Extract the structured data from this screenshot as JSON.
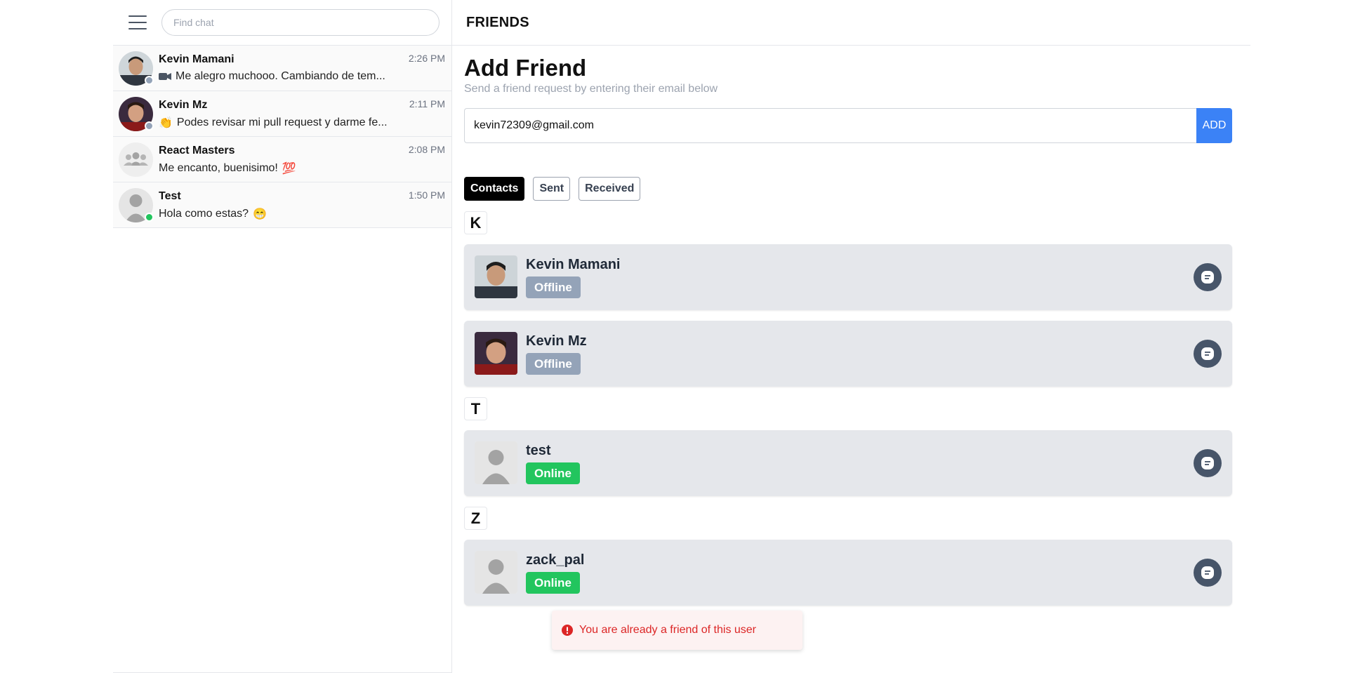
{
  "sidebar": {
    "search_placeholder": "Find chat",
    "chats": [
      {
        "name": "Kevin Mamani",
        "time": "2:26 PM",
        "message": "Me alegro muchooo. Cambiando de tem...",
        "icon": "video-camera-icon",
        "status": "offline"
      },
      {
        "name": "Kevin Mz",
        "time": "2:11 PM",
        "message": "Podes revisar mi pull request y darme fe...",
        "emoji": "👏",
        "status": "offline"
      },
      {
        "name": "React Masters",
        "time": "2:08 PM",
        "message": "Me encanto, buenisimo!",
        "emoji_after": "💯",
        "status": "group"
      },
      {
        "name": "Test",
        "time": "1:50 PM",
        "message": "Hola como estas?",
        "emoji_after": "😁",
        "status": "online"
      }
    ]
  },
  "header": {
    "title": "FRIENDS"
  },
  "add_friend": {
    "title": "Add Friend",
    "subtitle": "Send a friend request by entering their email below",
    "input_value": "kevin72309@gmail.com",
    "button_label": "ADD"
  },
  "tabs": [
    {
      "label": "Contacts",
      "active": true
    },
    {
      "label": "Sent",
      "active": false
    },
    {
      "label": "Received",
      "active": false
    }
  ],
  "groups": [
    {
      "letter": "K",
      "contacts": [
        {
          "name": "Kevin Mamani",
          "status": "Offline"
        },
        {
          "name": "Kevin Mz",
          "status": "Offline"
        }
      ]
    },
    {
      "letter": "T",
      "contacts": [
        {
          "name": "test",
          "status": "Online"
        }
      ]
    },
    {
      "letter": "Z",
      "contacts": [
        {
          "name": "zack_pal",
          "status": "Online"
        }
      ]
    }
  ],
  "toast": {
    "message": "You are already a friend of this user"
  },
  "colors": {
    "accent": "#3b82f6",
    "online": "#22c55e",
    "offline": "#94a3b8",
    "error": "#dc2626"
  }
}
